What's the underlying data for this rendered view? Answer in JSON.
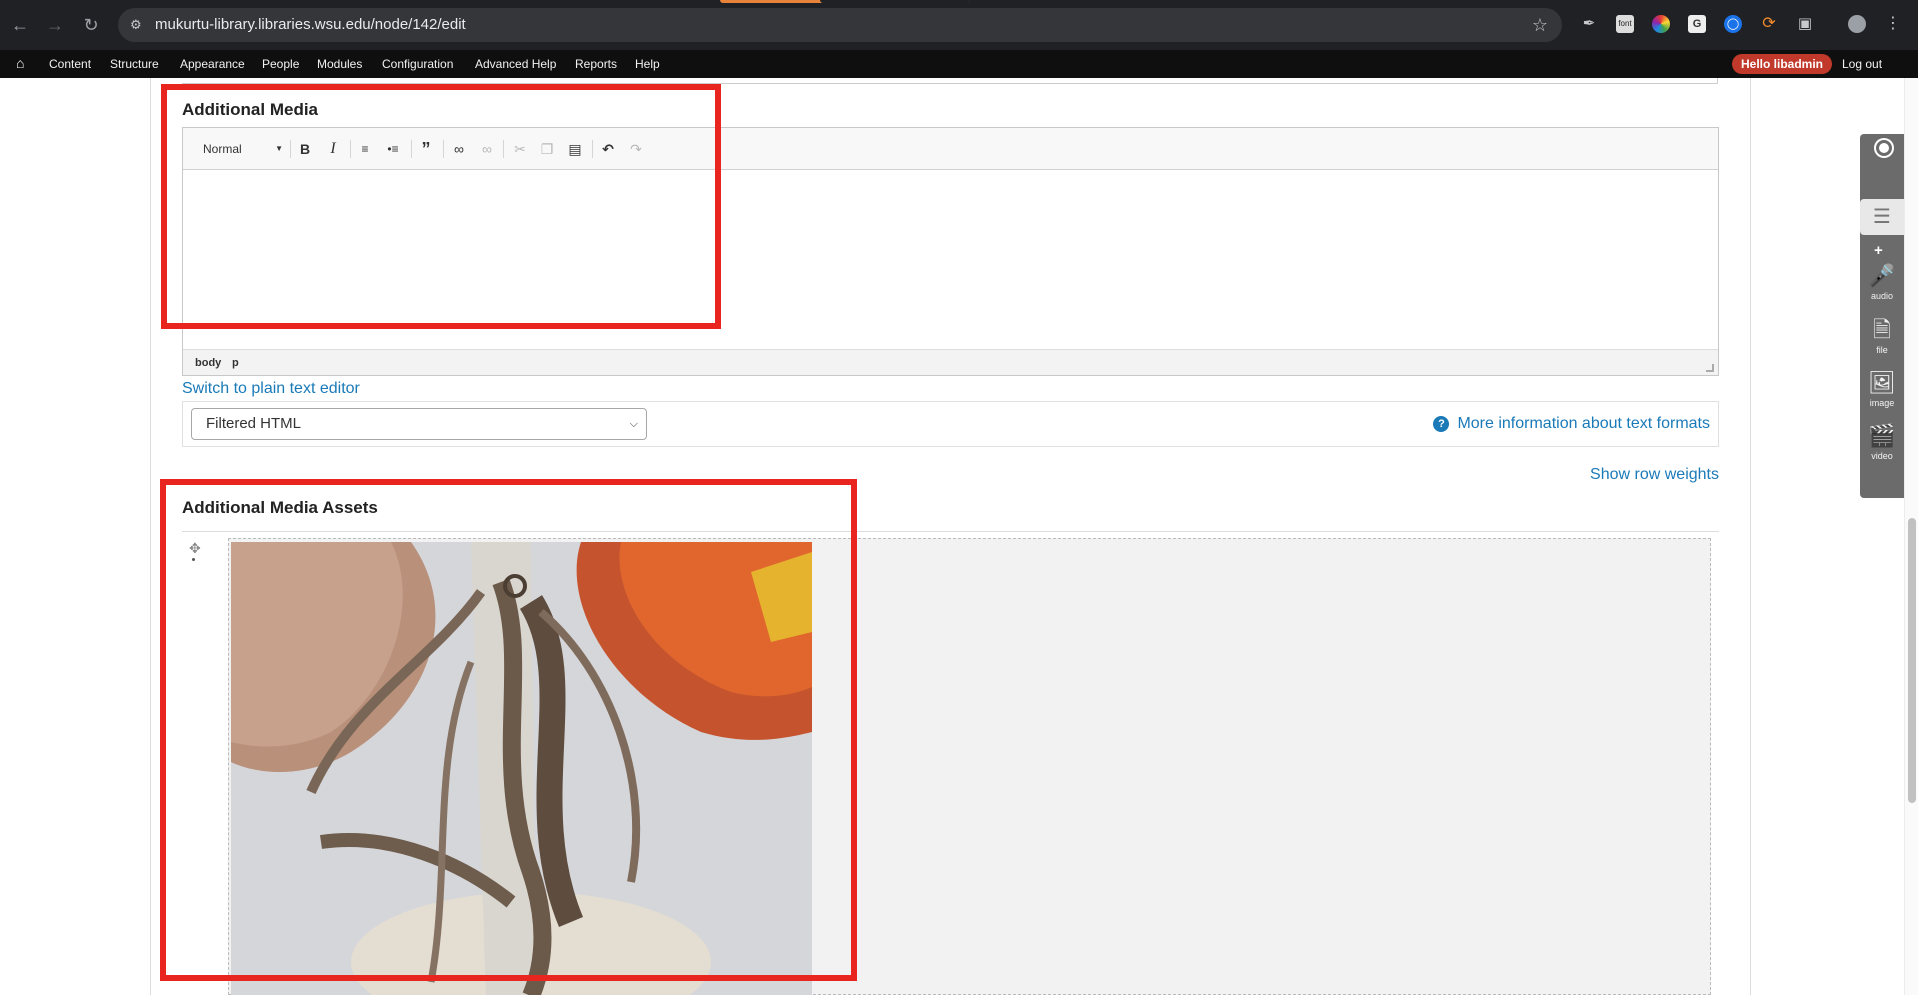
{
  "browser": {
    "url": "mukurtu-library.libraries.wsu.edu/node/142/edit",
    "accent_color": "#e8833a"
  },
  "toolbar": {
    "home_icon": "home-icon",
    "items": [
      "Content",
      "Structure",
      "Appearance",
      "People",
      "Modules",
      "Configuration",
      "Advanced Help",
      "Reports",
      "Help"
    ],
    "greeting": "Hello libadmin",
    "logout": "Log out"
  },
  "additional_media": {
    "title": "Additional Media",
    "format_label": "Normal",
    "status_path": [
      "body",
      "p"
    ],
    "switch_link": "Switch to plain text editor",
    "text_format_value": "Filtered HTML",
    "more_info": "More information about text formats"
  },
  "assets": {
    "row_weights": "Show row weights",
    "title": "Additional Media Assets"
  },
  "side_panel": {
    "items": [
      {
        "label": "audio",
        "icon": "microphone-icon"
      },
      {
        "label": "file",
        "icon": "file-icon"
      },
      {
        "label": "image",
        "icon": "image-icon"
      },
      {
        "label": "video",
        "icon": "video-clapper-icon"
      }
    ]
  },
  "highlight_color": "#e8261f",
  "link_color": "#1a7ab8"
}
